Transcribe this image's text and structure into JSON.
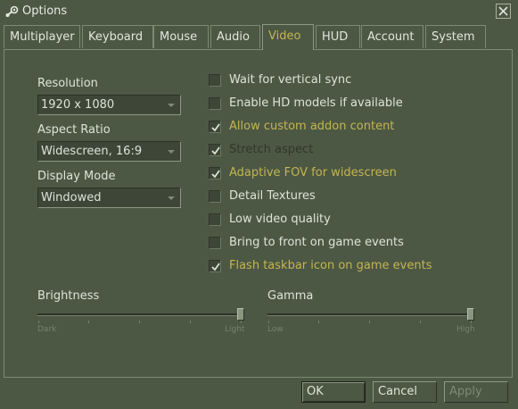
{
  "window": {
    "title": "Options",
    "icon": "steam-logo-icon",
    "close_icon": "close-icon"
  },
  "tabs": [
    {
      "label": "Multiplayer",
      "active": false
    },
    {
      "label": "Keyboard",
      "active": false
    },
    {
      "label": "Mouse",
      "active": false
    },
    {
      "label": "Audio",
      "active": false
    },
    {
      "label": "Video",
      "active": true
    },
    {
      "label": "HUD",
      "active": false
    },
    {
      "label": "Account",
      "active": false
    },
    {
      "label": "System",
      "active": false
    }
  ],
  "video": {
    "resolution": {
      "label": "Resolution",
      "value": "1920 x 1080"
    },
    "aspect_ratio": {
      "label": "Aspect Ratio",
      "value": "Widescreen, 16:9"
    },
    "display_mode": {
      "label": "Display Mode",
      "value": "Windowed"
    },
    "options": [
      {
        "label": "Wait for vertical sync",
        "checked": false,
        "enabled": true
      },
      {
        "label": "Enable HD models if available",
        "checked": false,
        "enabled": true
      },
      {
        "label": "Allow custom addon content",
        "checked": true,
        "enabled": true
      },
      {
        "label": "Stretch aspect",
        "checked": true,
        "enabled": false
      },
      {
        "label": "Adaptive FOV for widescreen",
        "checked": true,
        "enabled": true
      },
      {
        "label": "Detail Textures",
        "checked": false,
        "enabled": true
      },
      {
        "label": "Low video quality",
        "checked": false,
        "enabled": true
      },
      {
        "label": "Bring to front on game events",
        "checked": false,
        "enabled": true
      },
      {
        "label": "Flash taskbar icon on game events",
        "checked": true,
        "enabled": true
      }
    ],
    "brightness": {
      "label": "Brightness",
      "min_label": "Dark",
      "max_label": "Light",
      "level": 1.0
    },
    "gamma": {
      "label": "Gamma",
      "min_label": "Low",
      "max_label": "High",
      "level": 1.0
    }
  },
  "buttons": {
    "ok": "OK",
    "cancel": "Cancel",
    "apply": "Apply"
  },
  "colors": {
    "background": "#4c5844",
    "accent_text": "#c4b550",
    "text": "#dde3d8"
  }
}
